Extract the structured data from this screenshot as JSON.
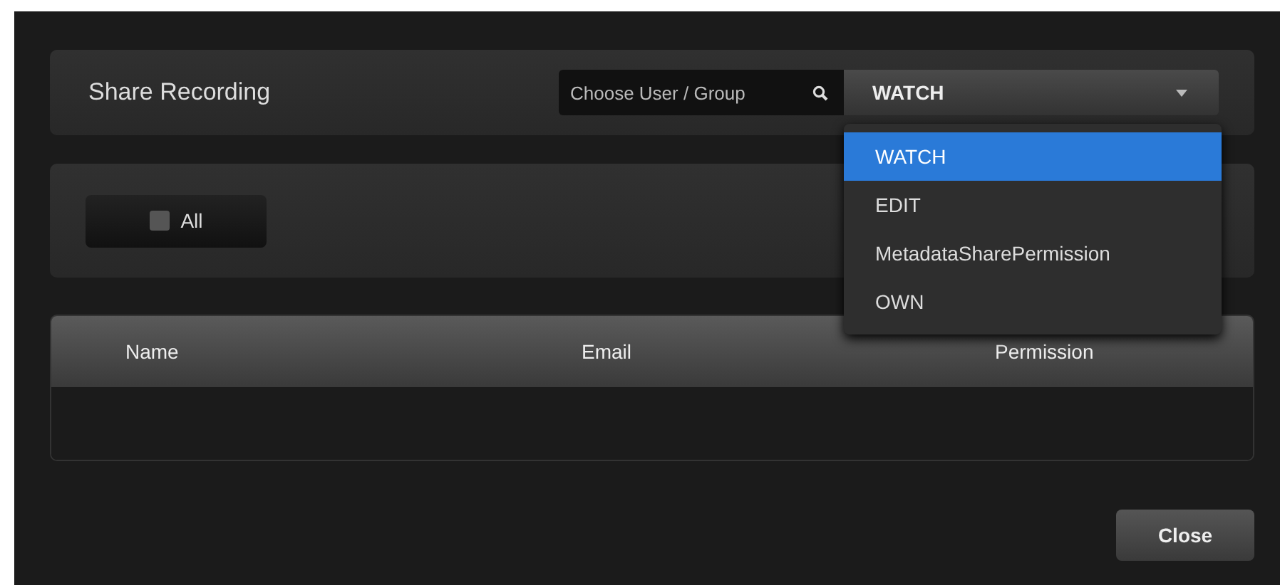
{
  "dialog": {
    "title": "Share Recording",
    "search": {
      "placeholder": "Choose User / Group"
    },
    "permission_select": {
      "value": "WATCH",
      "expanded": true,
      "options": [
        {
          "label": "WATCH",
          "selected": true
        },
        {
          "label": "EDIT",
          "selected": false
        },
        {
          "label": "MetadataSharePermission",
          "selected": false
        },
        {
          "label": "OWN",
          "selected": false
        }
      ]
    },
    "all_checkbox": {
      "label": "All",
      "checked": false
    },
    "table": {
      "columns": [
        "Name",
        "Email",
        "Permission"
      ]
    },
    "buttons": [
      "Close"
    ]
  }
}
